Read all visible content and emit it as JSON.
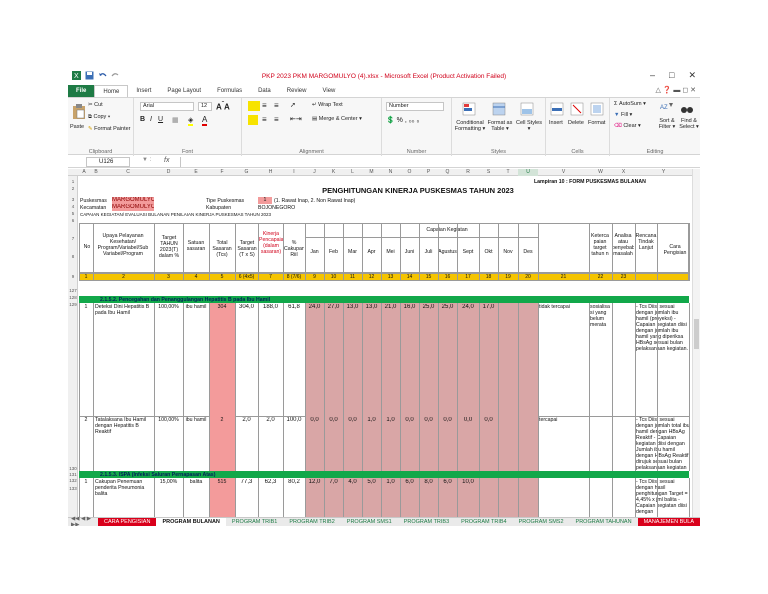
{
  "window": {
    "title": "PKP 2023 PKM MARGOMULYO (4).xlsx - Microsoft Excel (Product Activation Failed)"
  },
  "ribbon": {
    "tabs": [
      "File",
      "Home",
      "Insert",
      "Page Layout",
      "Formulas",
      "Data",
      "Review",
      "View"
    ],
    "active_tab": "Home",
    "clipboard": {
      "cut": "Cut",
      "copy": "Copy ▾",
      "paste": "Paste",
      "format_painter": "Format Painter",
      "label": "Clipboard"
    },
    "font": {
      "name": "Arial",
      "size": "12",
      "label": "Font"
    },
    "alignment": {
      "wrap": "Wrap Text",
      "merge": "Merge & Center ▾",
      "label": "Alignment"
    },
    "number": {
      "format": "Number",
      "label": "Number"
    },
    "styles": {
      "conditional": "Conditional Formatting ▾",
      "format_table": "Format as Table ▾",
      "cell_styles": "Cell Styles ▾",
      "label": "Styles"
    },
    "cells": {
      "insert": "Insert",
      "delete": "Delete",
      "format": "Format",
      "label": "Cells"
    },
    "editing": {
      "autosum": "AutoSum ▾",
      "fill": "Fill ▾",
      "clear": "Clear ▾",
      "sort": "Sort & Filter ▾",
      "find": "Find & Select ▾",
      "label": "Editing"
    }
  },
  "formula_bar": {
    "name_box": "U126",
    "fx": "fx",
    "content": ""
  },
  "sheet": {
    "lampiran": "Lampiran 10 : FORM PUSKESMAS BULANAN",
    "heading": "PENGHITUNGAN KINERJA PUSKESMAS TAHUN 2023",
    "row2_label": "Puskesmas",
    "row2_value": "MARGOMULYO",
    "tipe_label": "Tipe Puskesmas",
    "tipe_value": "1",
    "tipe_note": "(1. Rawat Inap, 2. Non Rawat Inap)",
    "row3_label": "Kecamatan",
    "row3_value": "MARGOMULYO",
    "kab_label": "Kabupaten",
    "kab_value": "BOJONEGORO",
    "row4_text": "CAPAIAN KEGIATAN/ EVALUASI BULANAN PENILAIAN KINERJA PUSKESMAS TAHUN 2023",
    "headers": {
      "no": "No",
      "upaya": "Upaya Pelayanan Kesehatan/ Program/Variabel/Sub Variabel/Program",
      "target": "Target TAHUN 2023(T) dalam %",
      "satuan": "Satuan sasaran",
      "total": "Total Sasaran (Tcs)",
      "target2": "Target Sasaran (T x S)",
      "kinerja": "Kinerja Pencapaian (dalam sasaran)",
      "cakupan": "% Cakupan Riil",
      "capaian": "Capaian Kegiatan",
      "months": [
        "Jan",
        "Feb",
        "Mar",
        "Apr",
        "Mei",
        "Juni",
        "Juli",
        "Agustus",
        "Sept",
        "Okt",
        "Nov",
        "Des"
      ],
      "ketercapaian": "Keterca paian target tahun n",
      "analisa": "Analisa atau penyebab masalah",
      "rencana": "Rencana Tindak Lanjut",
      "cara": "Cara Pengisian"
    },
    "index_row": [
      "1",
      "2",
      "3",
      "4",
      "5",
      "6 (4x5)",
      "7",
      "8 (7/6)",
      "9",
      "10",
      "11",
      "12",
      "13",
      "14",
      "15",
      "16",
      "17",
      "18",
      "19",
      "20",
      "21",
      "22",
      "23"
    ],
    "section1": "2.1.5.2. Pencegahan dan Penanggulangan Hepatitis B pada Ibu Hamil",
    "rows": [
      {
        "no": "1",
        "name": "Deteksi Dini Hepatitis B pada Ibu Hamil",
        "target": "100,00%",
        "satuan": "ibu hamil",
        "total": "304",
        "target2": "304,0",
        "kinerja": "188,0",
        "cakupan": "61,8",
        "months": [
          "24,0",
          "27,0",
          "13,0",
          "13,0",
          "21,0",
          "16,0",
          "25,0",
          "25,0",
          "24,0",
          "17,0",
          "",
          ""
        ],
        "ket": "tidak tercapai",
        "analisa": "sosialisa si yang belum merata",
        "rencana": "",
        "cara": "- Tcs Diisi sesuai dengan jumlah ibu hamil (proyeksi) - Capaian kegiatan diisi dengan jumlah ibu hamil yang diperiksa HBsAg sesuai bulan pelaksanaan kegiatan."
      },
      {
        "no": "2",
        "name": "Tatalaksana Ibu Hamil dengan Hepatitis B Reaktif",
        "target": "100,00%",
        "satuan": "ibu hamil",
        "total": "2",
        "target2": "2,0",
        "kinerja": "2,0",
        "cakupan": "100,0",
        "months": [
          "0,0",
          "0,0",
          "0,0",
          "1,0",
          "1,0",
          "0,0",
          "0,0",
          "0,0",
          "0,0",
          "0,0",
          "",
          ""
        ],
        "ket": "tercapai",
        "analisa": "",
        "rencana": "",
        "cara": "- Tcs Diisi sesuai dengan jumlah total ibu hamil dengan HBsAg Reaktif - Capaian kegiatan diisi dengan Jumlah ibu hamil dengan HBsAg Reaktif dirujuk sesuai bulan pelaksanaan kegiatan"
      }
    ],
    "section2": "2.1.5.3. ISPA (Infeksi Saluran Pernapasan Atas)",
    "row3": {
      "no": "1",
      "name": "Cakupan Penemuan penderita Pneumonia balita",
      "target": "15,00%",
      "satuan": "balita",
      "total": "515",
      "target2": "77,3",
      "kinerja": "62,3",
      "cakupan": "80,2",
      "months": [
        "12,0",
        "7,0",
        "4,0",
        "5,0",
        "1,0",
        "6,0",
        "8,0",
        "6,0",
        "10,0",
        "",
        "",
        ""
      ],
      "cara": "- Tcs Diisi sesuai dengan hasil penghitungan Target = 4,45% x jml balita - Capaian kegiatan diisi dengan"
    },
    "col_letters": [
      "A",
      "B",
      "C",
      "D",
      "E",
      "F",
      "G",
      "H",
      "I",
      "J",
      "K",
      "L",
      "M",
      "N",
      "O",
      "P",
      "Q",
      "R",
      "S",
      "T",
      "U",
      "V",
      "W",
      "X",
      "Y"
    ],
    "row_numbers": [
      "1",
      "2",
      "3",
      "4",
      "5",
      "6",
      "7",
      "8",
      "9",
      "127",
      "128",
      "129",
      "130",
      "131",
      "132",
      "133"
    ]
  },
  "sheet_tabs": [
    "CARA PENGISIAN",
    "PROGRAM BULANAN",
    "PROGRAM TRIB1",
    "PROGRAM TRIB2",
    "PROGRAM SMS1",
    "PROGRAM TRIB3",
    "PROGRAM TRIB4",
    "PROGRAM SMS2",
    "PROGRAM TAHUNAN",
    "MANAJEMEN BULA"
  ],
  "colors": {
    "excel_green": "#1e7b45",
    "highlight": "#f39b9b",
    "section_green": "#12a84a",
    "yellow_row": "#f5c400"
  }
}
